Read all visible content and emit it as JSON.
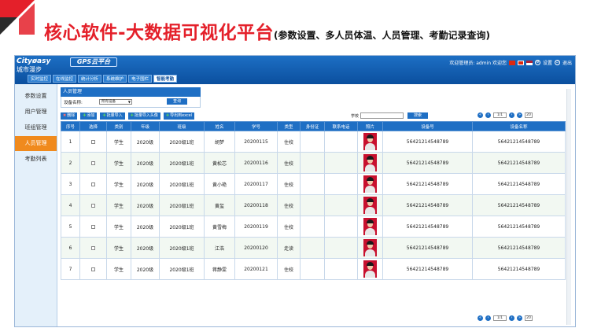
{
  "slide": {
    "title_main": "核心软件-大数据可视化平台",
    "title_sub": "(参数设置、多人员体温、人员管理、考勤记录查询)",
    "accent_color": "#e4202a"
  },
  "app": {
    "brand_en": "Cityøasy",
    "brand_cn": "城市漫步",
    "gps_logo": "GPS云平台",
    "welcome": "欢迎管理员: admin 欢迎您",
    "settings_label": "设置",
    "logout_label": "退出",
    "menu": [
      "实时监控",
      "在线监控",
      "统计分析",
      "系统维护",
      "电子围栏",
      "智能考勤"
    ],
    "menu_active_index": 5
  },
  "sidebar": {
    "items": [
      "参数设置",
      "用户管理",
      "班组管理",
      "人员管理",
      "考勤列表"
    ],
    "active_index": 3
  },
  "filter": {
    "panel_title": "人员管理",
    "device_label": "设备名称:",
    "device_value": "所有设备",
    "query_button": "查询"
  },
  "toolbar": {
    "delete": "删除",
    "add": "添加",
    "batch_import": "批量导入",
    "batch_import_photo": "批量导入头像",
    "export": "导出到excel"
  },
  "search": {
    "label": "学校",
    "button": "搜索"
  },
  "pager": {
    "page_text": "1/1",
    "page_size": "20"
  },
  "table": {
    "headers": [
      "序号",
      "选择",
      "类别",
      "年级",
      "班级",
      "姓名",
      "学号",
      "类型",
      "身份证",
      "联系电话",
      "照片",
      "设备号",
      "设备名称"
    ],
    "rows": [
      [
        "1",
        "",
        "学生",
        "2020级",
        "2020级1班",
        "胡梦",
        "20200115",
        "住校",
        "",
        "",
        "",
        "5642121454878​9",
        "56421214548789"
      ],
      [
        "2",
        "",
        "学生",
        "2020级",
        "2020级1班",
        "黄松芯",
        "20200116",
        "住校",
        "",
        "",
        "",
        "56421214548789",
        "56421214548789"
      ],
      [
        "3",
        "",
        "学生",
        "2020级",
        "2020级1班",
        "黄小艳",
        "20200117",
        "住校",
        "",
        "",
        "",
        "56421214548789",
        "56421214548789"
      ],
      [
        "4",
        "",
        "学生",
        "2020级",
        "2020级1班",
        "黄玺",
        "20200118",
        "住校",
        "",
        "",
        "",
        "56421214548789",
        "56421214548789"
      ],
      [
        "5",
        "",
        "学生",
        "2020级",
        "2020级1班",
        "黄雪梅",
        "20200119",
        "住校",
        "",
        "",
        "",
        "56421214548789",
        "56421214548789"
      ],
      [
        "6",
        "",
        "学生",
        "2020级",
        "2020级1班",
        "江浩",
        "20200120",
        "走读",
        "",
        "",
        "",
        "56421214548789",
        "56421214548789"
      ],
      [
        "7",
        "",
        "学生",
        "2020级",
        "2020级1班",
        "蒋静雯",
        "20200121",
        "住校",
        "",
        "",
        "",
        "56421214548789",
        "56421214548789"
      ]
    ]
  }
}
